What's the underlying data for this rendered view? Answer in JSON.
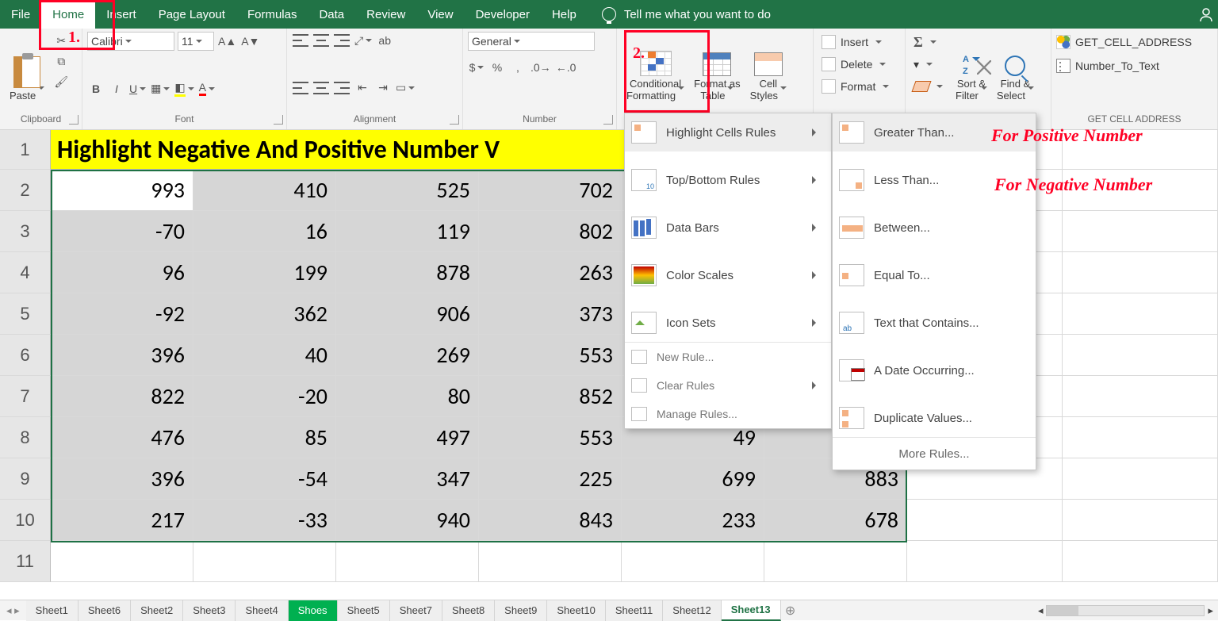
{
  "tabs": [
    "File",
    "Home",
    "Insert",
    "Page Layout",
    "Formulas",
    "Data",
    "Review",
    "View",
    "Developer",
    "Help"
  ],
  "tellme": "Tell me what you want to do",
  "callouts": {
    "n1": "1.",
    "n2": "2."
  },
  "ribbon": {
    "clipboard": {
      "paste": "Paste",
      "label": "Clipboard"
    },
    "font": {
      "name": "Calibri",
      "size": "11",
      "label": "Font"
    },
    "alignment": {
      "label": "Alignment"
    },
    "number": {
      "format": "General",
      "label": "Number"
    },
    "styles": {
      "cf": "Conditional\nFormatting",
      "fat": "Format as\nTable",
      "cs": "Cell\nStyles"
    },
    "cells": {
      "insert": "Insert",
      "delete": "Delete",
      "format": "Format"
    },
    "editing": {
      "sort": "Sort &\nFilter",
      "find": "Find &\nSelect"
    },
    "addins": {
      "a1": "GET_CELL_ADDRESS",
      "a2": "Number_To_Text",
      "label": "GET CELL ADDRESS"
    }
  },
  "cf_menu": {
    "items": [
      "Highlight Cells Rules",
      "Top/Bottom Rules",
      "Data Bars",
      "Color Scales",
      "Icon Sets"
    ],
    "small": [
      "New Rule...",
      "Clear Rules",
      "Manage Rules..."
    ]
  },
  "hcr_menu": {
    "items": [
      "Greater Than...",
      "Less Than...",
      "Between...",
      "Equal To...",
      "Text that Contains...",
      "A Date Occurring...",
      "Duplicate Values..."
    ],
    "more": "More Rules..."
  },
  "annots": {
    "pos": "For Positive Number",
    "neg": "For Negative Number"
  },
  "title_row": "Highlight Negative And Positive Number V",
  "rows": [
    [
      993,
      410,
      525,
      702,
      null,
      null
    ],
    [
      -70,
      16,
      119,
      802,
      null,
      null
    ],
    [
      96,
      199,
      878,
      263,
      null,
      null
    ],
    [
      -92,
      362,
      906,
      373,
      null,
      null
    ],
    [
      396,
      40,
      269,
      553,
      null,
      null
    ],
    [
      822,
      -20,
      80,
      852,
      null,
      null
    ],
    [
      476,
      85,
      497,
      553,
      49,
      null
    ],
    [
      396,
      -54,
      347,
      225,
      699,
      883
    ],
    [
      217,
      -33,
      940,
      843,
      233,
      678
    ]
  ],
  "row_numbers": [
    "1",
    "2",
    "3",
    "4",
    "5",
    "6",
    "7",
    "8",
    "9",
    "10",
    "11"
  ],
  "sheet_tabs": [
    "Sheet1",
    "Sheet6",
    "Sheet2",
    "Sheet3",
    "Sheet4",
    "Shoes",
    "Sheet5",
    "Sheet7",
    "Sheet8",
    "Sheet9",
    "Sheet10",
    "Sheet11",
    "Sheet12",
    "Sheet13"
  ]
}
